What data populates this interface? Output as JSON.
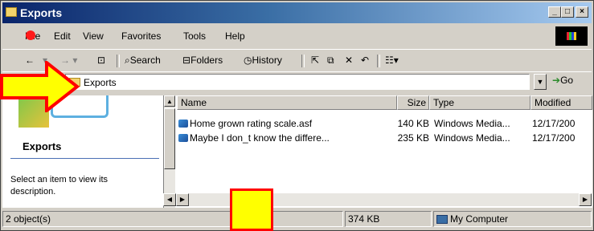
{
  "window": {
    "title": "Exports"
  },
  "menu": [
    "File",
    "Edit",
    "View",
    "Favorites",
    "Tools",
    "Help"
  ],
  "toolbar": {
    "back_label": "Back",
    "search_label": "Search",
    "folders_label": "Folders",
    "history_label": "History"
  },
  "address": {
    "label": "Address",
    "value": "Exports",
    "go_label": "Go"
  },
  "left_pane": {
    "title": "Exports",
    "description": "Select an item to view its description."
  },
  "list": {
    "columns": [
      "Name",
      "Size",
      "Type",
      "Modified"
    ],
    "rows": [
      {
        "name": "Home grown rating scale.asf",
        "size": "140 KB",
        "type": "Windows Media...",
        "modified": "12/17/200"
      },
      {
        "name": "Maybe I don_t know the differe...",
        "size": "235 KB",
        "type": "Windows Media...",
        "modified": "12/17/200"
      }
    ]
  },
  "status": {
    "objects": "2 object(s)",
    "size": "374 KB",
    "zone": "My Computer"
  },
  "colors": {
    "arrow_fill": "#ffff00",
    "arrow_outline": "#ff0000",
    "title_gradient_start": "#0a246a"
  }
}
